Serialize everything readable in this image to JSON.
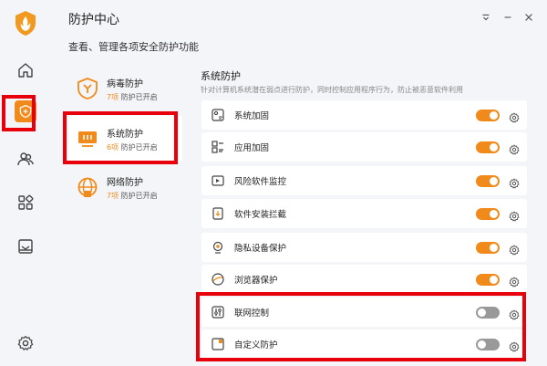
{
  "header": {
    "title": "防护中心",
    "subtitle": "查看、管理各项安全防护功能"
  },
  "rail": {
    "items": [
      "home",
      "protection",
      "users",
      "apps",
      "toolbox",
      "settings"
    ]
  },
  "categories": [
    {
      "name": "病毒防护",
      "count": "7项",
      "status": "防护已开启"
    },
    {
      "name": "系统防护",
      "count": "6项",
      "status": "防护已开启"
    },
    {
      "name": "网络防护",
      "count": "7项",
      "status": "防护已开启"
    }
  ],
  "section": {
    "title": "系统防护",
    "desc": "针对计算机系统潜在弱点进行防护，同时控制应用程序行为，防止被恶意软件利用"
  },
  "rows": [
    {
      "label": "系统加固",
      "on": true
    },
    {
      "label": "应用加固",
      "on": true
    },
    {
      "label": "风险软件监控",
      "on": true
    },
    {
      "label": "软件安装拦截",
      "on": true
    },
    {
      "label": "隐私设备保护",
      "on": true
    },
    {
      "label": "浏览器保护",
      "on": true
    },
    {
      "label": "联网控制",
      "on": false
    },
    {
      "label": "自定义防护",
      "on": false
    }
  ],
  "colors": {
    "accent": "#f08a1a",
    "highlight": "#e8000b"
  }
}
